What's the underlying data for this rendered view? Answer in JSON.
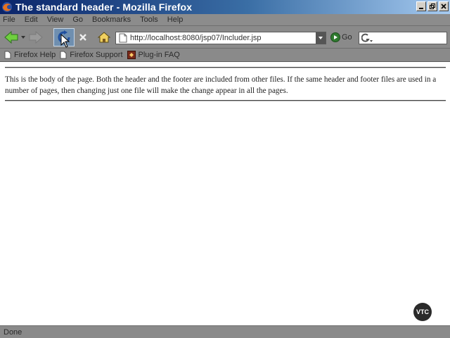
{
  "window": {
    "title": "The standard header - Mozilla Firefox"
  },
  "menu": {
    "items": [
      "File",
      "Edit",
      "View",
      "Go",
      "Bookmarks",
      "Tools",
      "Help"
    ]
  },
  "navigation": {
    "url": "http://localhost:8080/jsp07/Includer.jsp",
    "go_label": "Go",
    "search_value": ""
  },
  "bookmarks": {
    "items": [
      "Firefox Help",
      "Firefox Support",
      "Plug-in FAQ"
    ]
  },
  "page": {
    "body_text": "This is the body of the page. Both the header and the footer are included from other files. If the same header and footer files are used in a number of pages, then changing just one file will make the change appear in all the pages."
  },
  "watermark": {
    "label": "VTC"
  },
  "status": {
    "text": "Done"
  },
  "colors": {
    "titlebar_start": "#0a246a",
    "chrome_gray": "#8a8a8a",
    "content_bg": "#ffffff"
  }
}
